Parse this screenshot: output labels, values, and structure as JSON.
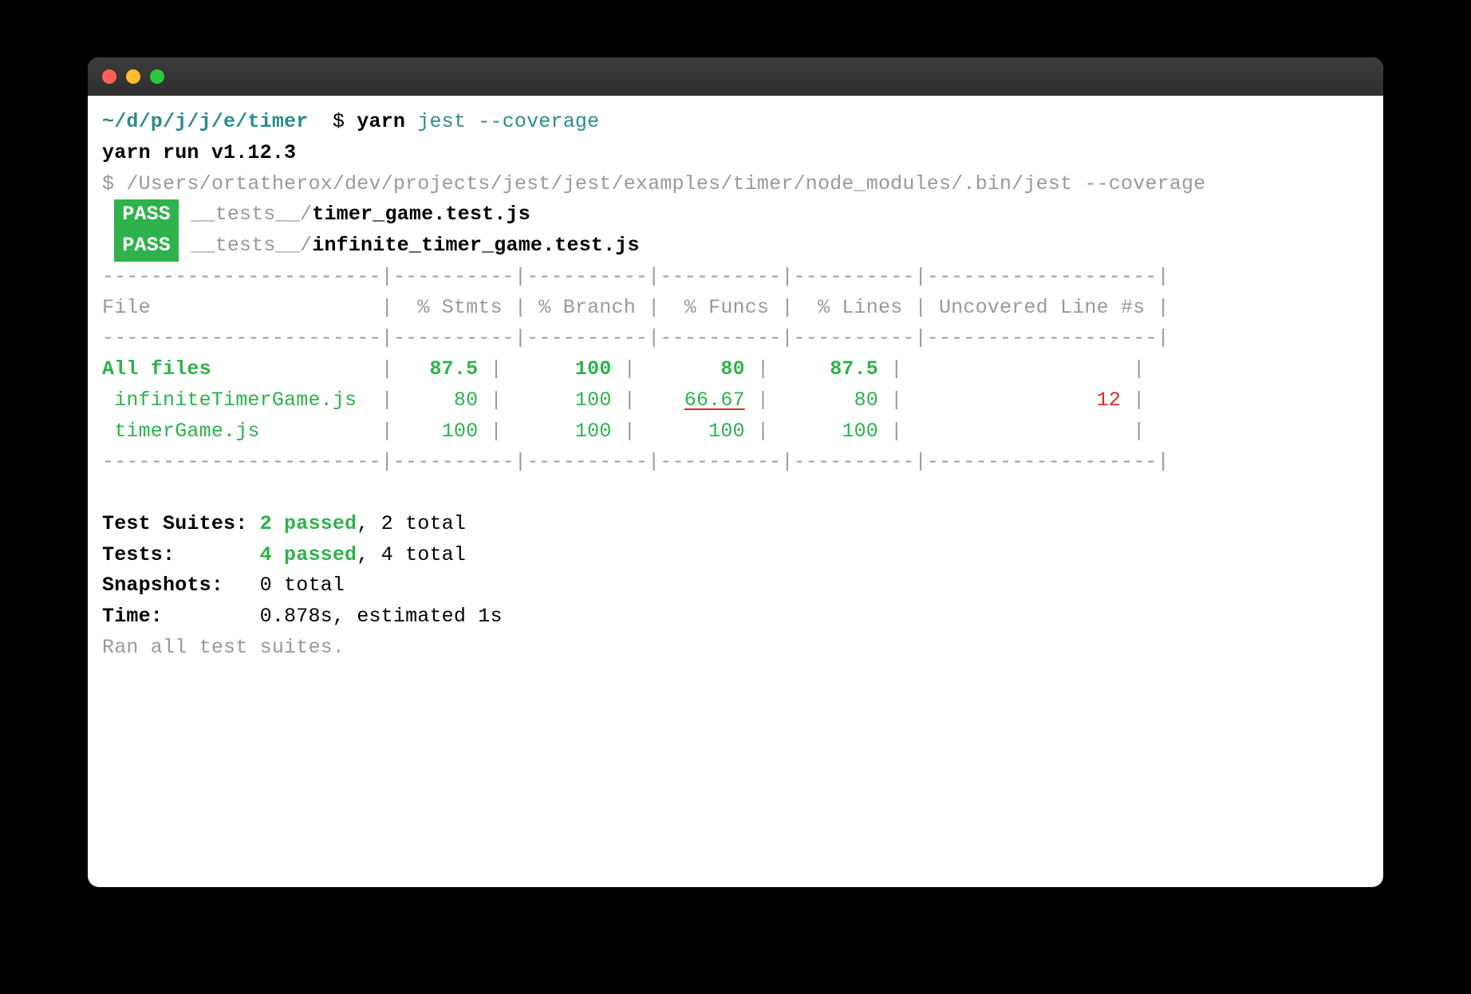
{
  "prompt": {
    "path": "~/d/p/j/j/e/timer",
    "symbol": "$",
    "cmd_yarn": "yarn",
    "cmd_jest": "jest",
    "cmd_flag": "--coverage"
  },
  "yarn_run": "yarn run v1.12.3",
  "subcmd": {
    "symbol": "$",
    "path": "/Users/ortatherox/dev/projects/jest/jest/examples/timer/node_modules/.bin/jest --coverage"
  },
  "tests": [
    {
      "badge": "PASS",
      "dir": "__tests__/",
      "file": "timer_game.test.js"
    },
    {
      "badge": "PASS",
      "dir": "__tests__/",
      "file": "infinite_timer_game.test.js"
    }
  ],
  "table": {
    "sep": "-----------------------|----------|----------|----------|----------|-------------------|",
    "header": "File                   |  % Stmts | % Branch |  % Funcs |  % Lines | Uncovered Line #s |",
    "rows": [
      {
        "name": "All files",
        "pad_after_name": "              |   ",
        "stmts": "87.5",
        "sep1": " |      ",
        "branch": "100",
        "sep2": " |       ",
        "funcs": "80",
        "sep3": " |     ",
        "lines": "87.5",
        "sep4": " |                   |",
        "uncovered": "",
        "uncovered_style": ""
      },
      {
        "name": " infiniteTimerGame.js",
        "pad_after_name": "  |     ",
        "stmts": "80",
        "sep1": " |      ",
        "branch": "100",
        "sep2": " |    ",
        "funcs": "66.67",
        "funcs_style": "underline",
        "sep3": " |       ",
        "lines": "80",
        "sep4": " |                ",
        "uncovered": "12",
        "uncovered_style": "red",
        "sep5": " |"
      },
      {
        "name": " timerGame.js",
        "pad_after_name": "          |    ",
        "stmts": "100",
        "sep1": " |      ",
        "branch": "100",
        "sep2": " |      ",
        "funcs": "100",
        "sep3": " |      ",
        "lines": "100",
        "sep4": " |                   |",
        "uncovered": "",
        "uncovered_style": ""
      }
    ]
  },
  "summary": {
    "suites_label": "Test Suites: ",
    "suites_passed": "2 passed",
    "suites_rest": ", 2 total",
    "tests_label": "Tests:       ",
    "tests_passed": "4 passed",
    "tests_rest": ", 4 total",
    "snapshots_label": "Snapshots:   ",
    "snapshots_value": "0 total",
    "time_label": "Time:        ",
    "time_value": "0.878s, estimated 1s",
    "ran": "Ran all test suites."
  }
}
